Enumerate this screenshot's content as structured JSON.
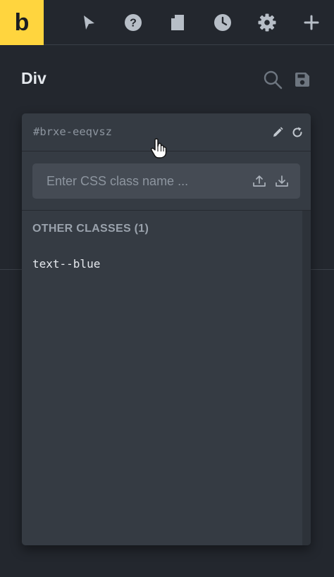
{
  "app": {
    "logo_letter": "b",
    "accent_color": "#ffd53e"
  },
  "toolbar": {
    "icons": [
      "pointer-icon",
      "help-icon",
      "page-icon",
      "history-icon",
      "settings-icon",
      "plus-icon"
    ]
  },
  "panel": {
    "title": "Div"
  },
  "popup": {
    "element_id": "#brxe-eeqvsz",
    "input_placeholder": "Enter CSS class name ...",
    "input_value": "",
    "section_title": "OTHER CLASSES (1)",
    "classes": [
      "text--blue"
    ]
  }
}
